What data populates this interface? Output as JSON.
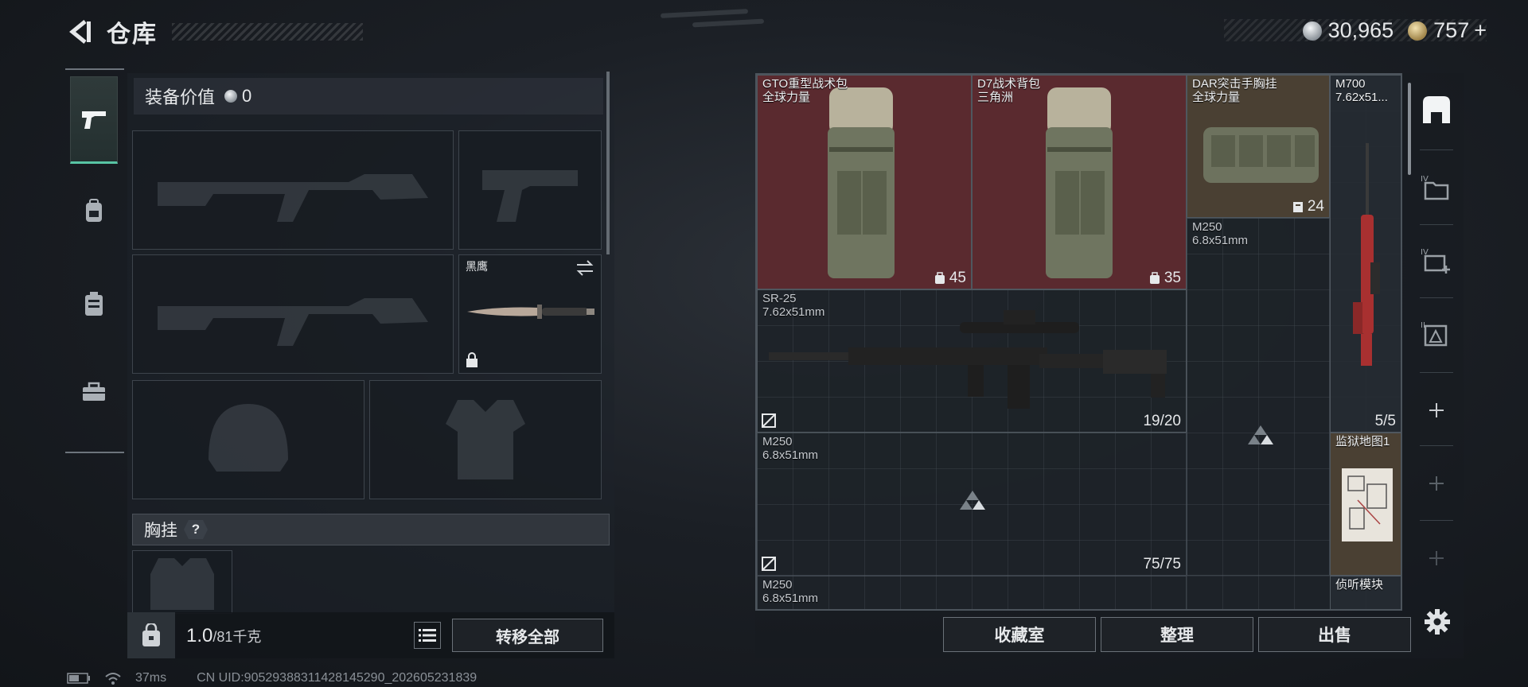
{
  "header": {
    "title": "仓库"
  },
  "currency": {
    "silver": "30,965",
    "gold": "757",
    "plus": "+"
  },
  "loadout": {
    "equip_value_label": "装备价值",
    "equip_value": "0",
    "knife_name": "黑鹰",
    "chest_rig_label": "胸挂",
    "help_mark": "?"
  },
  "bottom_left": {
    "weight_current": "1.0",
    "weight_max": "/81千克",
    "transfer_all": "转移全部"
  },
  "status": {
    "ping": "37ms",
    "uid": "CN UID:905293883114281452​90_202605231839"
  },
  "stash_items": [
    {
      "name": "GTO重型战术包",
      "sub": "全球力量",
      "count": "45"
    },
    {
      "name": "D7战术背包",
      "sub": "三角洲",
      "count": "35"
    },
    {
      "name": "DAR突击手胸挂",
      "sub": "全球力量",
      "count": "24"
    },
    {
      "name": "M700",
      "sub": "7.62x51...",
      "count": "5/5"
    },
    {
      "name": "M250",
      "sub": "6.8x51mm"
    },
    {
      "name": "SR-25",
      "sub": "7.62x51mm",
      "count": "19/20"
    },
    {
      "name": "M250",
      "sub": "6.8x51mm",
      "count": "75/75"
    },
    {
      "name": "监狱地图1"
    },
    {
      "name": "M250",
      "sub": "6.8x51mm"
    },
    {
      "name": "侦听模块"
    }
  ],
  "actions": {
    "collection": "收藏室",
    "organize": "整理",
    "sell": "出售"
  },
  "icons": [
    "back-arrow-icon",
    "silver-coin-icon",
    "gold-coin-icon",
    "pistol-icon",
    "backpack-icon",
    "chest-rig-icon",
    "toolbox-icon",
    "lock-icon",
    "swap-icon",
    "list-icon",
    "gear-icon",
    "home-icon"
  ],
  "colors": {
    "accent_teal": "#58c4a4",
    "item_red": "#5a2a2f",
    "item_tan": "#4a4033"
  }
}
